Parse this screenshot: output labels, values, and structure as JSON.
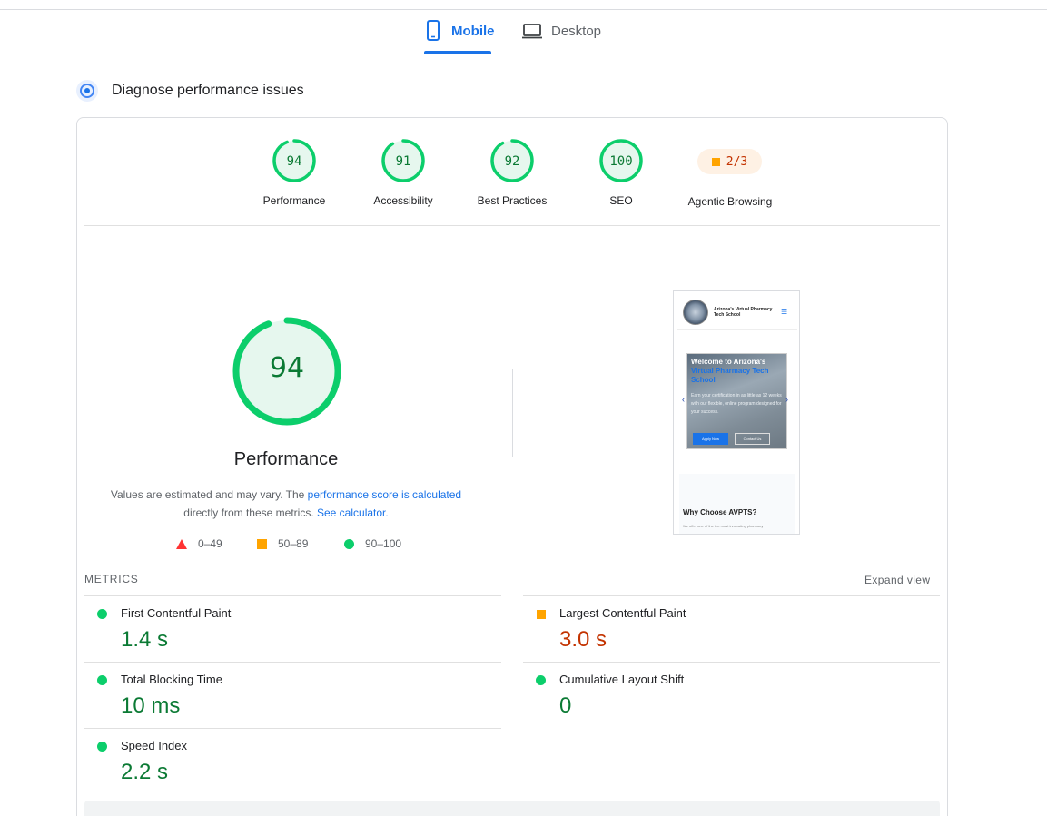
{
  "tabs": {
    "mobile": "Mobile",
    "desktop": "Desktop",
    "active": "Mobile"
  },
  "diagnose": {
    "title": "Diagnose performance issues"
  },
  "categories": [
    {
      "label": "Performance",
      "score": "94",
      "value": 94
    },
    {
      "label": "Accessibility",
      "score": "91",
      "value": 91
    },
    {
      "label": "Best Practices",
      "score": "92",
      "value": 92
    },
    {
      "label": "SEO",
      "score": "100",
      "value": 100
    }
  ],
  "agentic": {
    "label": "Agentic Browsing",
    "score": "2/3"
  },
  "performance": {
    "score": "94",
    "value": 94,
    "label": "Performance",
    "desc_prefix": "Values are estimated and may vary. The ",
    "desc_link1": "performance score is calculated",
    "desc_middle": " directly from these metrics.",
    "desc_link2": "See calculator.",
    "legend": {
      "fail": "0–49",
      "average": "50–89",
      "pass": "90–100"
    }
  },
  "thumbnail": {
    "brand": "Arizona's Virtual Pharmacy Tech School",
    "hero_title_white": "Welcome to Arizona's",
    "hero_title_blue": "Virtual Pharmacy Tech School",
    "hero_text": "Earn your certification in as little as 12 weeks with our flexible, online program designed for your success.",
    "apply": "Apply Now",
    "contact": "Contact Us",
    "section_title": "Why Choose AVPTS?",
    "section_sub": "We offer one of the the most innovating pharmacy"
  },
  "metrics": {
    "heading": "METRICS",
    "expand": "Expand view",
    "items": [
      {
        "name": "First Contentful Paint",
        "value": "1.4 s",
        "rating": "pass"
      },
      {
        "name": "Largest Contentful Paint",
        "value": "3.0 s",
        "rating": "average"
      },
      {
        "name": "Total Blocking Time",
        "value": "10 ms",
        "rating": "pass"
      },
      {
        "name": "Cumulative Layout Shift",
        "value": "0",
        "rating": "pass"
      },
      {
        "name": "Speed Index",
        "value": "2.2 s",
        "rating": "pass"
      }
    ]
  },
  "colors": {
    "pass": "#0cce6b",
    "pass_text": "#0b7a34",
    "average": "#ffa400",
    "average_text": "#c33300",
    "fail": "#ff3333",
    "accent": "#1a73e8"
  }
}
